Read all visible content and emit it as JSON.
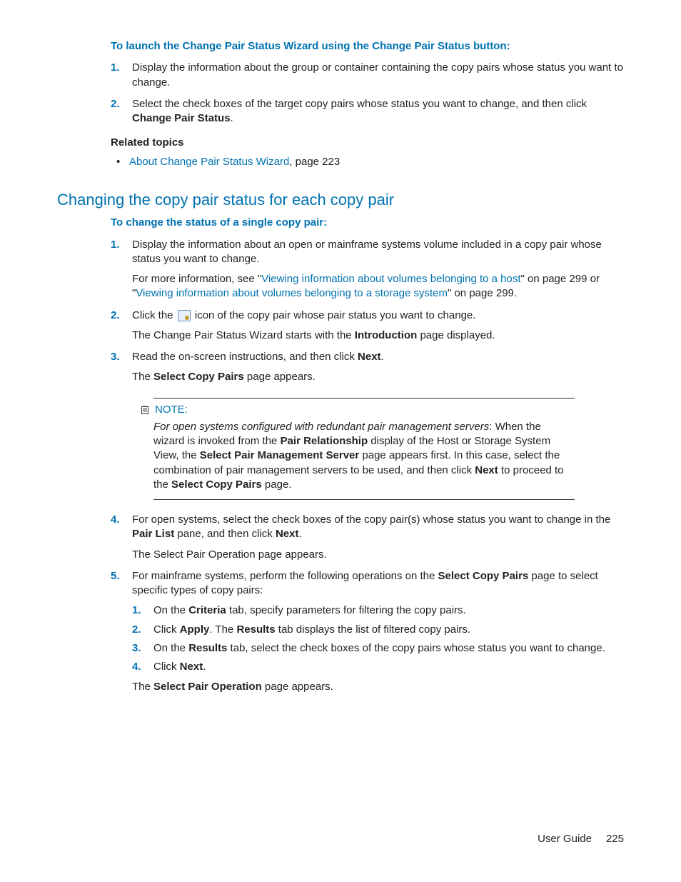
{
  "intro1": "To launch the Change Pair Status Wizard using the Change Pair Status button:",
  "s1": {
    "i1a": "Display the information about the group or container containing the copy pairs whose status you want to change.",
    "i2a": "Select the check boxes of the target copy pairs whose status you want to change, and then click ",
    "i2b": "Change Pair Status",
    "i2c": "."
  },
  "related_h": "Related topics",
  "related_link": "About Change Pair Status Wizard",
  "related_tail": ", page 223",
  "section_h": "Changing the copy pair status for each copy pair",
  "intro2": "To change the status of a single copy pair:",
  "s2": {
    "i1a": "Display the information about an open or mainframe systems volume included in a copy pair whose status you want to change.",
    "i1p_a": "For more information, see \"",
    "i1p_link1": "Viewing information about volumes belonging to a host",
    "i1p_b": "\" on page 299 or \"",
    "i1p_link2": "Viewing information about volumes belonging to a storage system",
    "i1p_c": "\" on page 299.",
    "i2a": "Click the ",
    "i2b": " icon of the copy pair whose pair status you want to change.",
    "i2p_a": "The Change Pair Status Wizard starts with the ",
    "i2p_b": "Introduction",
    "i2p_c": " page displayed.",
    "i3a": "Read the on-screen instructions, and then click ",
    "i3b": "Next",
    "i3c": ".",
    "i3p_a": "The ",
    "i3p_b": "Select Copy Pairs",
    "i3p_c": " page appears.",
    "i4a": "For open systems, select the check boxes of the copy pair(s) whose status you want to change in the ",
    "i4b": "Pair List",
    "i4c": " pane, and then click ",
    "i4d": "Next",
    "i4e": ".",
    "i4p": "The Select Pair Operation page appears.",
    "i5a": "For mainframe systems, perform the following operations on the ",
    "i5b": "Select Copy Pairs",
    "i5c": " page to select specific types of copy pairs:",
    "sub": {
      "a1": "On the ",
      "a2": "Criteria",
      "a3": " tab, specify parameters for filtering the copy pairs.",
      "b1": "Click ",
      "b2": "Apply",
      "b3": ". The ",
      "b4": "Results",
      "b5": " tab displays the list of filtered copy pairs.",
      "c1": "On the ",
      "c2": "Results",
      "c3": " tab, select the check boxes of the copy pairs whose status you want to change.",
      "d1": "Click ",
      "d2": "Next",
      "d3": "."
    },
    "i5p_a": "The ",
    "i5p_b": "Select Pair Operation",
    "i5p_c": " page appears."
  },
  "note": {
    "label": "NOTE:",
    "a": "For open systems configured with redundant pair management servers",
    "b": ": When the wizard is invoked from the ",
    "c": "Pair Relationship",
    "d": " display of the Host or Storage System View, the ",
    "e": "Select Pair Management Server",
    "f": " page appears first. In this case, select the combination of pair management servers to be used, and then click ",
    "g": "Next",
    "h": " to proceed to the ",
    "i": "Select Copy Pairs",
    "j": " page."
  },
  "footer_label": "User Guide",
  "footer_page": "225"
}
